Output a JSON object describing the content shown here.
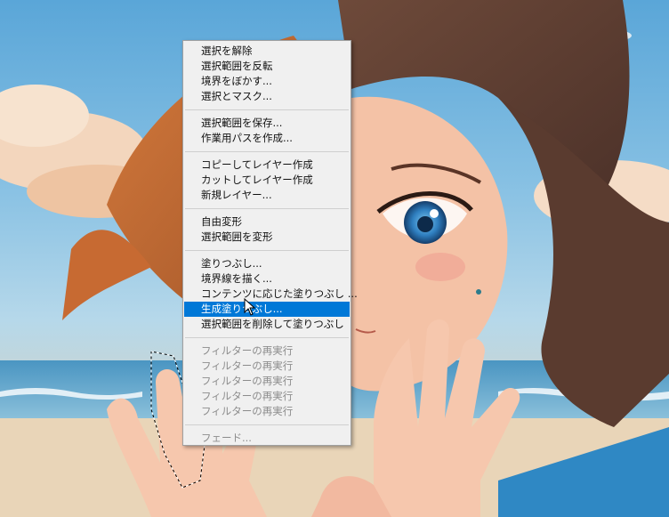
{
  "context_menu": {
    "groups": [
      [
        "選択を解除",
        "選択範囲を反転",
        "境界をぼかす...",
        "選択とマスク..."
      ],
      [
        "選択範囲を保存...",
        "作業用パスを作成..."
      ],
      [
        "コピーしてレイヤー作成",
        "カットしてレイヤー作成",
        "新規レイヤー..."
      ],
      [
        "自由変形",
        "選択範囲を変形"
      ],
      [
        "塗りつぶし...",
        "境界線を描く...",
        "コンテンツに応じた塗りつぶし ...",
        "生成塗りつぶし...",
        "選択範囲を削除して塗りつぶし"
      ],
      [
        "フィルターの再実行",
        "フィルターの再実行",
        "フィルターの再実行",
        "フィルターの再実行",
        "フィルターの再実行"
      ],
      [
        "フェード..."
      ]
    ],
    "highlighted_item": "生成塗りつぶし...",
    "disabled_groups": [
      5,
      6
    ],
    "colors": {
      "highlight": "#0078d7",
      "menu_background": "#f0f0f0",
      "disabled_text": "#8c8c8c"
    }
  },
  "icons": {
    "cursor": "arrow-cursor-icon"
  }
}
